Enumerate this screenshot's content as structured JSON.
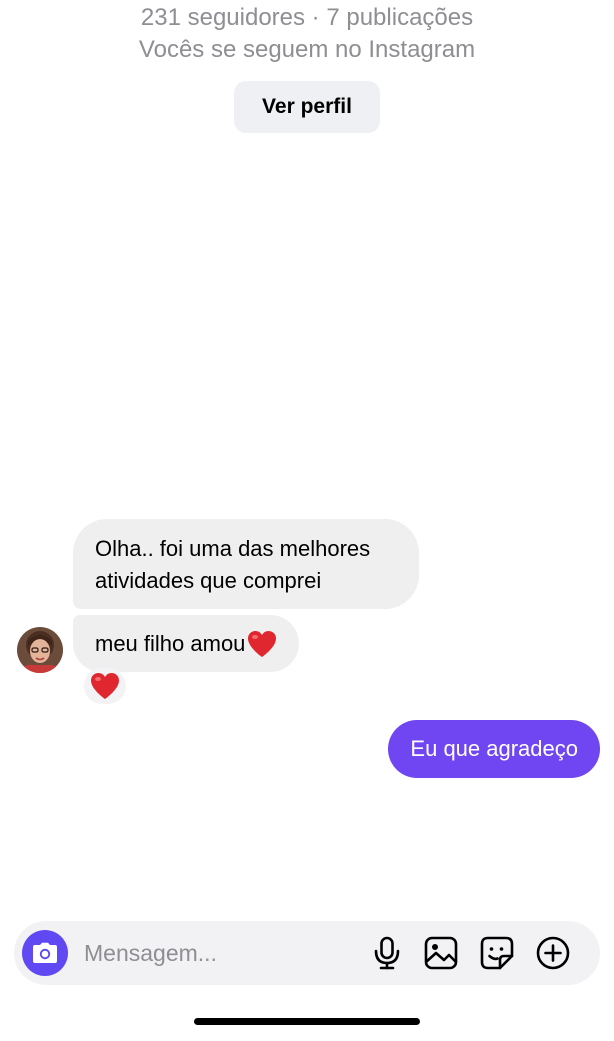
{
  "profile": {
    "stats": "231 seguidores · 7 publicações",
    "follow_status": "Vocês se seguem no Instagram",
    "view_profile_label": "Ver perfil"
  },
  "messages": [
    {
      "from": "them",
      "text_line1": "Olha.. foi uma das melhores",
      "text_line2": "atividades que comprei"
    },
    {
      "from": "them",
      "text": "meu filho amou",
      "emoji": "❤️",
      "reaction": "❤️"
    },
    {
      "from": "me",
      "text": "Eu que agradeço"
    }
  ],
  "composer": {
    "placeholder": "Mensagem..."
  },
  "icons": {
    "camera": "camera-icon",
    "microphone": "microphone-icon",
    "gallery": "gallery-icon",
    "sticker": "sticker-icon",
    "plus": "plus-circle-icon"
  },
  "colors": {
    "outgoing_bubble": "#7045f2",
    "incoming_bubble": "#efefef",
    "camera_button": "#6049f3",
    "reaction_heart": "#e0262f"
  }
}
